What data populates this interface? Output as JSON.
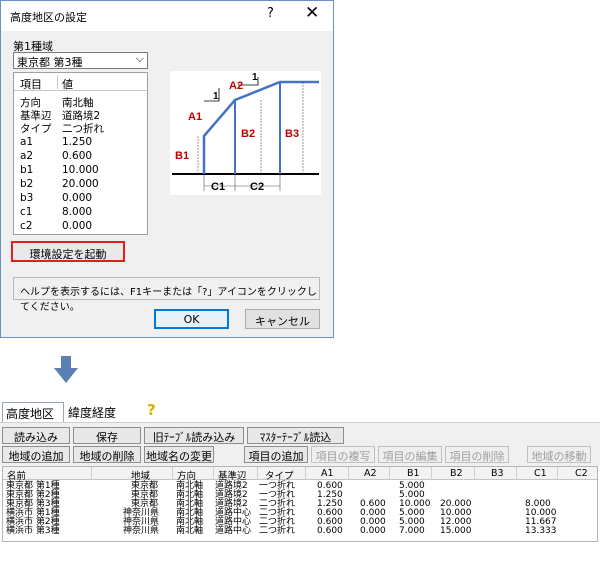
{
  "dialog": {
    "title": "高度地区の設定",
    "help_glyph": "?",
    "close_glyph": "✕",
    "region_label": "第1種域",
    "region_value": "東京都 第3種",
    "dropdown_glyph": "⌵",
    "list_headers": {
      "item": "項目",
      "value": "値"
    },
    "properties": [
      {
        "key": "方向",
        "value": "南北軸"
      },
      {
        "key": "基準辺",
        "value": "道路境2"
      },
      {
        "key": "タイプ",
        "value": "二つ折れ"
      },
      {
        "key": "a1",
        "value": "1.250"
      },
      {
        "key": "a2",
        "value": "0.600"
      },
      {
        "key": "b1",
        "value": "10.000"
      },
      {
        "key": "b2",
        "value": "20.000"
      },
      {
        "key": "b3",
        "value": "0.000"
      },
      {
        "key": "c1",
        "value": "8.000"
      },
      {
        "key": "c2",
        "value": "0.000"
      }
    ],
    "env_button": "環境設定を起動",
    "help_text": "ヘルプを表示するには、F1キーまたは「?」アイコンをクリックしてください。",
    "ok_label": "OK",
    "cancel_label": "キャンセル",
    "diagram_labels": {
      "a1": "A1",
      "a2": "A2",
      "b1": "B1",
      "b2": "B2",
      "b3": "B3",
      "c1": "C1",
      "c2": "C2",
      "one_a": "1",
      "one_b": "1"
    },
    "accent_color": "#4472c4",
    "label_color": "#c00000",
    "highlight_color": "#e0201b"
  },
  "panel": {
    "tabs": [
      "高度地区",
      "緯度経度",
      "?"
    ],
    "toolbar_row1": [
      "読み込み",
      "保存",
      "旧ﾃｰﾌﾞﾙ読み込み",
      "ﾏｽﾀｰﾃｰﾌﾞﾙ読込"
    ],
    "toolbar_row2": [
      "地域の追加",
      "地域の削除",
      "地域名の変更",
      "項目の追加",
      "項目の複写",
      "項目の編集",
      "項目の削除",
      "地域の移動"
    ],
    "columns": [
      "名前",
      "地域",
      "方向",
      "基準辺",
      "タイプ",
      "A1",
      "A2",
      "B1",
      "B2",
      "B3",
      "C1",
      "C2"
    ],
    "rows": [
      [
        "東京都 第1種",
        "東京都",
        "南北軸",
        "道路境2",
        "一つ折れ",
        "0.600",
        "",
        "5.000",
        "",
        "",
        "",
        ""
      ],
      [
        "東京都 第2種",
        "東京都",
        "南北軸",
        "道路境2",
        "一つ折れ",
        "1.250",
        "",
        "5.000",
        "",
        "",
        "",
        ""
      ],
      [
        "東京都 第3種",
        "東京都",
        "南北軸",
        "道路境2",
        "二つ折れ",
        "1.250",
        "0.600",
        "10.000",
        "20.000",
        "",
        "8.000",
        ""
      ],
      [
        "横浜市 第1種",
        "神奈川県",
        "南北軸",
        "道路中心",
        "二つ折れ",
        "0.600",
        "0.000",
        "5.000",
        "10.000",
        "",
        "10.000",
        ""
      ],
      [
        "横浜市 第2種",
        "神奈川県",
        "南北軸",
        "道路中心",
        "二つ折れ",
        "0.600",
        "0.000",
        "5.000",
        "12.000",
        "",
        "11.667",
        ""
      ],
      [
        "横浜市 第3種",
        "神奈川県",
        "南北軸",
        "道路中心",
        "二つ折れ",
        "0.600",
        "0.000",
        "7.000",
        "15.000",
        "",
        "13.333",
        ""
      ]
    ]
  }
}
